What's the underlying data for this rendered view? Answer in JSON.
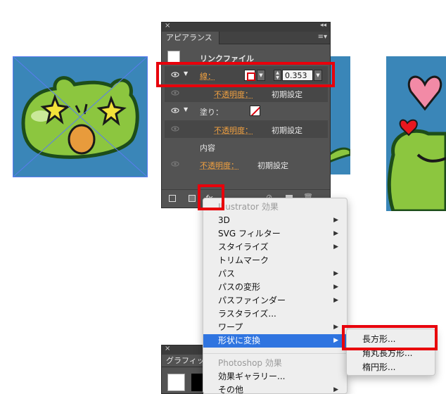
{
  "colors": {
    "panel_bg": "#535353",
    "highlight": "#e8000b",
    "menu_selected": "#2f74e0",
    "artwork_blue": "#3a86b8",
    "frog_green": "#8cc63f",
    "opacity_label": "#f0a040"
  },
  "appearance_panel": {
    "tab": "アピアランス",
    "rows": {
      "linked_file": "リンクファイル",
      "stroke_label": "線：",
      "stroke_value": "0.353",
      "stroke_opacity_label": "不透明度：",
      "stroke_opacity_value": "初期設定",
      "fill_label": "塗り：",
      "fill_opacity_label": "不透明度：",
      "fill_opacity_value": "初期設定",
      "contents": "内容",
      "opacity_label": "不透明度：",
      "opacity_value": "初期設定"
    },
    "footer_fx": "fx"
  },
  "effect_menu": {
    "illustrator_header": "Illustrator 効果",
    "items": [
      {
        "label": "3D",
        "arrow": true
      },
      {
        "label": "SVG フィルター",
        "arrow": true
      },
      {
        "label": "スタイライズ",
        "arrow": true
      },
      {
        "label": "トリムマーク",
        "arrow": false
      },
      {
        "label": "パス",
        "arrow": true
      },
      {
        "label": "パスの変形",
        "arrow": true
      },
      {
        "label": "パスファインダー",
        "arrow": true
      },
      {
        "label": "ラスタライズ...",
        "arrow": false
      },
      {
        "label": "ワープ",
        "arrow": true
      },
      {
        "label": "形状に変換",
        "arrow": true,
        "selected": true
      }
    ],
    "photoshop_header": "Photoshop 効果",
    "ps_items": [
      {
        "label": "効果ギャラリー...",
        "arrow": false
      },
      {
        "label": "その他",
        "arrow": true
      }
    ]
  },
  "shape_submenu": {
    "items": [
      "長方形...",
      "角丸長方形...",
      "楕円形..."
    ]
  },
  "graphic_styles_panel": {
    "tab": "グラフィック"
  }
}
